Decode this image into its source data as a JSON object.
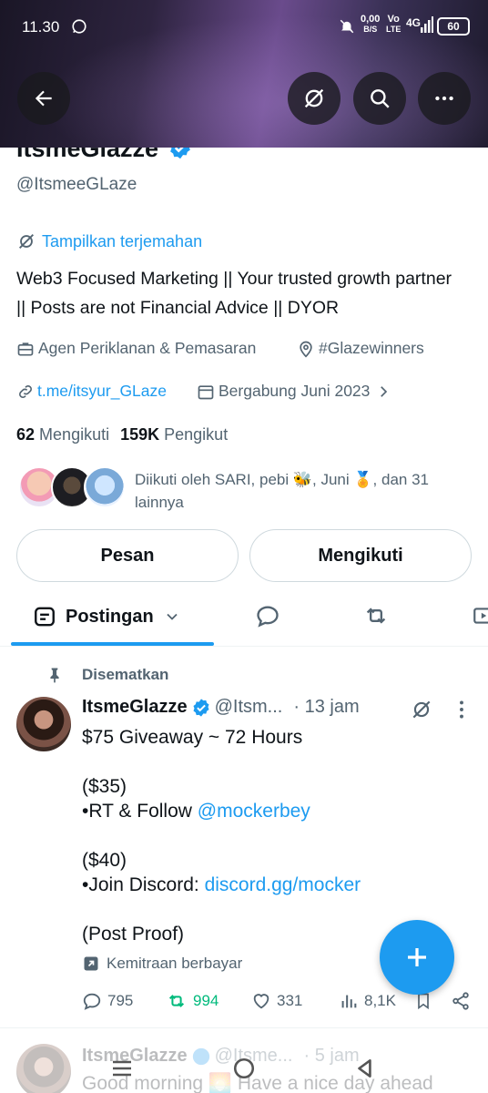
{
  "status_bar": {
    "time": "11.30",
    "speed": "0,00",
    "speed_unit": "B/S",
    "network1": "Vo",
    "network1b": "LTE",
    "network2": "4G",
    "battery": "60"
  },
  "profile": {
    "name": "ItsmeGlazze",
    "handle": "@ItsmeeGLaze",
    "translate": "Tampilkan terjemahan",
    "bio": "Web3 Focused Marketing || Your trusted growth partner || Posts are not Financial Advice || DYOR",
    "category": "Agen Periklanan & Pemasaran",
    "location": "#Glazewinners",
    "website": "t.me/itsyur_GLaze",
    "joined": "Bergabung Juni 2023",
    "following_count": "62",
    "following_label": "Mengikuti",
    "followers_count": "159K",
    "followers_label": "Pengikut",
    "followed_by": "Diikuti oleh SARI, pebi 🐝, Juni 🏅, dan 31 lainnya",
    "message_button": "Pesan",
    "follow_button": "Mengikuti"
  },
  "tabs": {
    "active": "Postingan"
  },
  "pinned_post": {
    "pinned_label": "Disematkan",
    "author": "ItsmeGlazze",
    "handle": "@Itsm...",
    "time": "· 13 jam",
    "line1": "$75 Giveaway ~ 72 Hours",
    "line2": "($35)",
    "line3_prefix": "•RT & Follow ",
    "line3_link": "@mockerbey",
    "line4": "($40)",
    "line5_prefix": "•Join Discord: ",
    "line5_link": "discord.gg/mocker",
    "line6": "(Post Proof)",
    "paid_partnership": "Kemitraan berbayar",
    "replies": "795",
    "reposts": "994",
    "likes": "331",
    "views": "8,1K"
  },
  "next_post": {
    "author": "ItsmeGlazze",
    "handle": "@Itsme...",
    "time": "· 5 jam",
    "text": "Good morning 🌅 Have a nice day ahead"
  },
  "colors": {
    "accent": "#1d9bf0",
    "repost_active": "#00ba7c",
    "muted": "#536471"
  }
}
